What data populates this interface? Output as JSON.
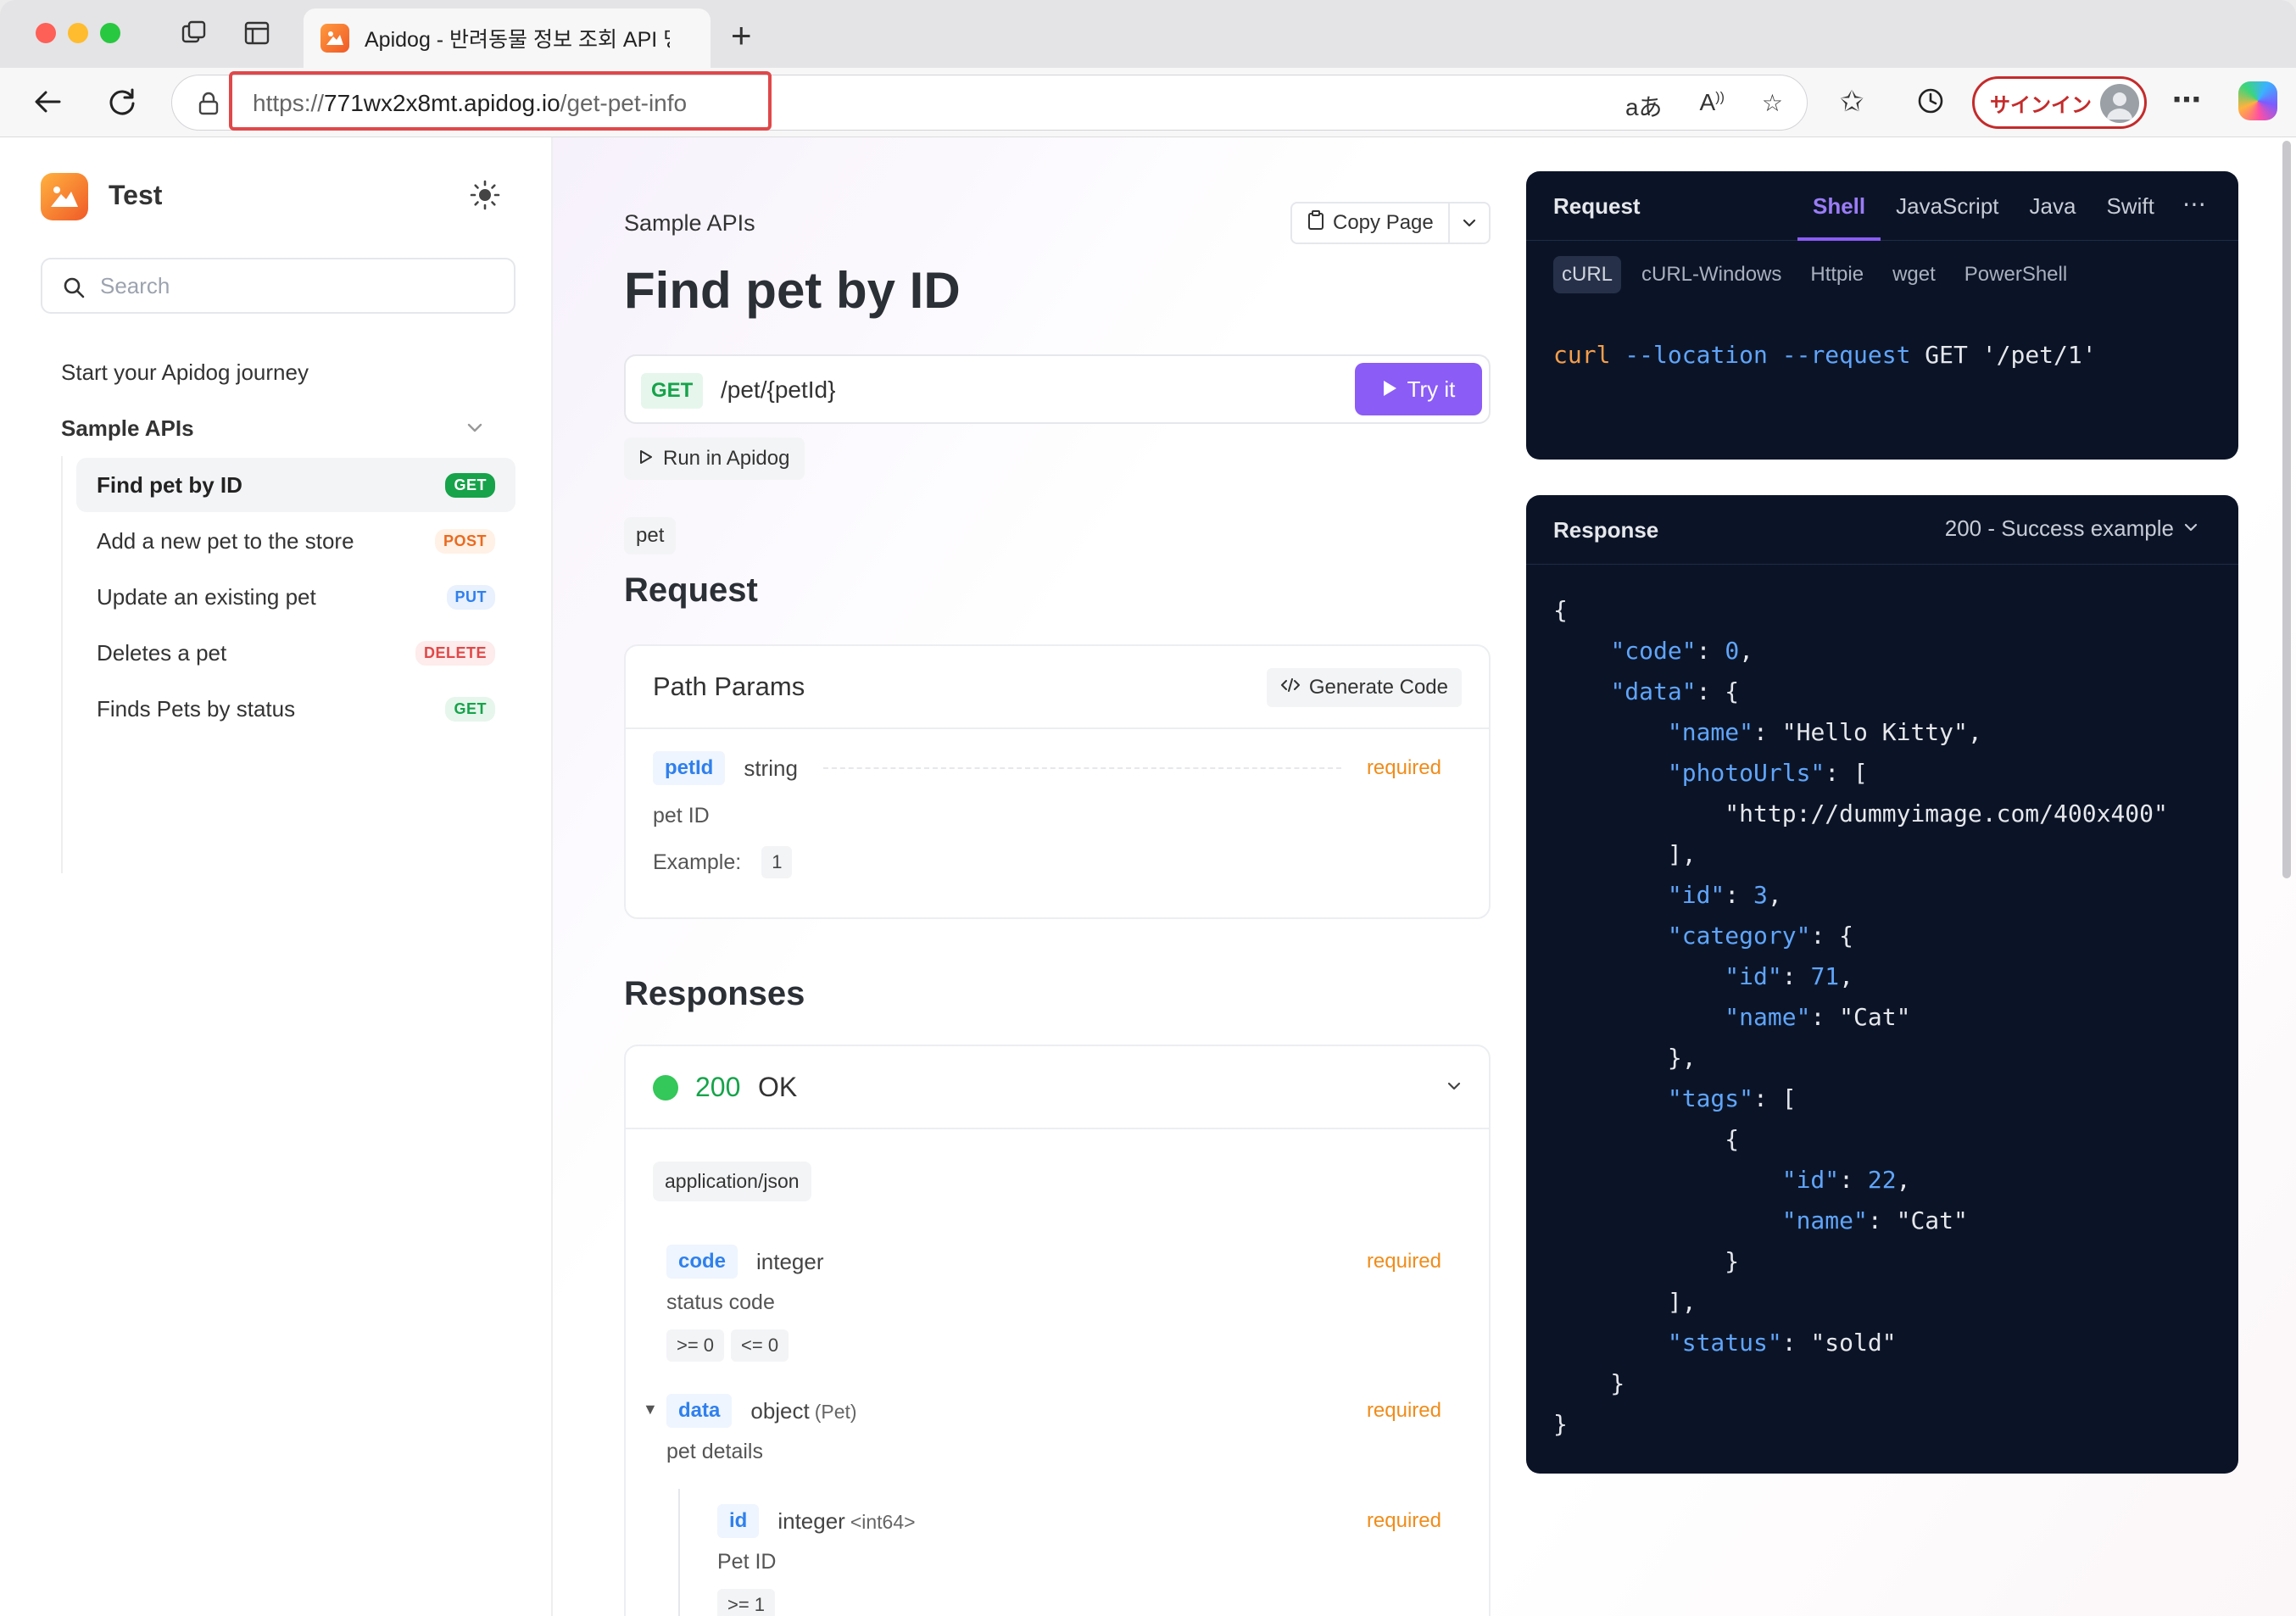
{
  "browser": {
    "tab_title": "Apidog - 반려동물 정보 조회 API 명",
    "url_prefix": "https://",
    "url_host": "771wx2x8mt.apidog.io",
    "url_path": "/get-pet-info",
    "signin_label": "サインイン"
  },
  "sidebar": {
    "brand": "Test",
    "search_placeholder": "Search",
    "journey": "Start your Apidog journey",
    "group": "Sample APIs",
    "items": [
      {
        "label": "Find pet by ID",
        "method": "GET"
      },
      {
        "label": "Add a new pet to the store",
        "method": "POST"
      },
      {
        "label": "Update an existing pet",
        "method": "PUT"
      },
      {
        "label": "Deletes a pet",
        "method": "DELETE"
      },
      {
        "label": "Finds Pets by status",
        "method": "GET"
      }
    ]
  },
  "doc": {
    "breadcrumb": "Sample APIs",
    "copy_page": "Copy Page",
    "title": "Find pet by ID",
    "method": "GET",
    "path": "/pet/{petId}",
    "try_it": "Try it",
    "run_in_apidog": "Run in Apidog",
    "tag": "pet",
    "request_heading": "Request",
    "path_params": {
      "title": "Path Params",
      "generate_code": "Generate Code",
      "param": {
        "name": "petId",
        "type": "string",
        "required": "required",
        "description": "pet ID",
        "example_label": "Example:",
        "example_value": "1"
      }
    },
    "responses_heading": "Responses",
    "response": {
      "code": "200",
      "status": "OK",
      "content_type": "application/json",
      "fields": {
        "code": {
          "name": "code",
          "type": "integer",
          "required": "required",
          "description": "status code",
          "constraints": [
            ">= 0",
            "<= 0"
          ]
        },
        "data": {
          "name": "data",
          "type": "object",
          "type_sub": "(Pet)",
          "required": "required",
          "description": "pet details"
        },
        "id": {
          "name": "id",
          "type": "integer",
          "type_sub": "<int64>",
          "required": "required",
          "description": "Pet ID",
          "constraint": ">= 1"
        }
      }
    }
  },
  "request_panel": {
    "label": "Request",
    "lang_tabs": [
      "Shell",
      "JavaScript",
      "Java",
      "Swift"
    ],
    "active_lang": "Shell",
    "sub_tabs": [
      "cURL",
      "cURL-Windows",
      "Httpie",
      "wget",
      "PowerShell"
    ],
    "active_sub": "cURL",
    "code": {
      "cmd": "curl",
      "flags": " --location --request",
      "rest": " GET '/pet/1'"
    }
  },
  "response_panel": {
    "label": "Response",
    "example": "200 - Success example",
    "json": {
      "code": 0,
      "name": "Hello Kitty",
      "photo_url": "http://dummyimage.com/400x400",
      "id": 3,
      "category_id": 71,
      "category_name": "Cat",
      "tag_id": 22,
      "tag_name": "Cat",
      "status": "sold"
    }
  },
  "colors": {
    "accent": "#8b5cf6",
    "get": "#16a34a",
    "post": "#ea6a1f",
    "put": "#2f80ed",
    "delete": "#e0484a",
    "required": "#f08c1a",
    "dark_panel": "#0b1427"
  }
}
